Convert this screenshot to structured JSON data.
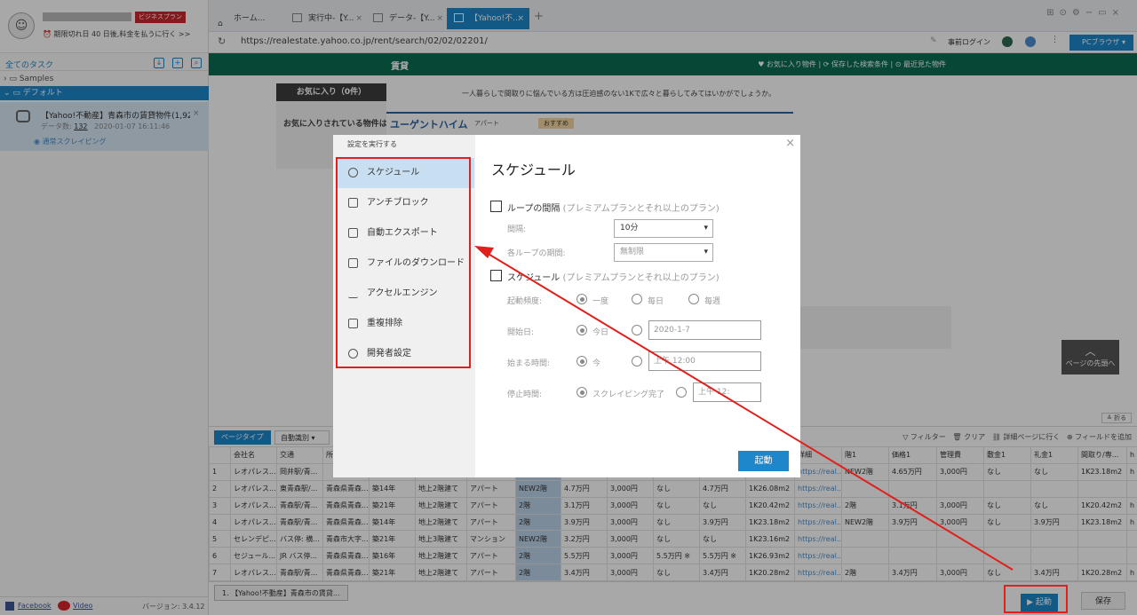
{
  "sidebar": {
    "account_badge": "ビジネスプラン",
    "expire_text": "期限切れ日 40 日後,料金を払うに行く >>",
    "task_header": "全てのタスク",
    "folder_samples": "Samples",
    "folder_default": "デフォルト",
    "task": {
      "title": "【Yahoo!不動産】青森市の賃貸物件(1,929...",
      "count_label": "データ数:",
      "count": "132",
      "date": "2020-01-07 16:11:46",
      "status": "通常スクレイピング"
    },
    "footer": {
      "facebook": "Facebook",
      "video": "Video",
      "version": "バージョン: 3.4.12"
    }
  },
  "browser": {
    "tabs": [
      {
        "label": "ホーム...",
        "active": false
      },
      {
        "label": "実行中-【Y...",
        "active": false
      },
      {
        "label": "データ-【Y...",
        "active": false
      },
      {
        "label": "【Yahoo!不...",
        "active": true
      }
    ],
    "url": "https://realestate.yahoo.co.jp/rent/search/02/02/02201/",
    "login": "事前ログイン",
    "pc_browser": "PCブラウザ"
  },
  "webpage": {
    "header_title": "賃貸",
    "nav": "♥ お気に入り物件  |  ⟳ 保存した検索条件  |  ⊙ 最近見た物件",
    "fav_title": "お気に入り（0件）",
    "fav_text": "お気に入りされている物件はあり",
    "promo": "一人暮らしで間取りに悩んでいる方は圧迫感のない1Kで広々と暮らしてみてはいかがでしょうか。",
    "urgent_title": "ユーゲントハイム",
    "urgent_type": "アパート",
    "urgent_tag": "おすすめ",
    "top_button": "ページの先頭へ",
    "fold": "折る"
  },
  "data_panel": {
    "page_type": "ページタイプ",
    "page_type_value": "自動識別",
    "tools": [
      "フィルター",
      "クリア",
      "詳細ページに行く",
      "フィールドを追加"
    ],
    "columns": [
      "",
      "会社名",
      "交通",
      "所",
      "",
      "",
      "",
      "",
      "",
      "",
      "",
      "",
      "",
      "詳細",
      "階1",
      "価格1",
      "管理費",
      "敷金1",
      "礼金1",
      "間取り/専...",
      "h"
    ],
    "rows": [
      [
        "1",
        "レオパレス...",
        "岡井駅/青...",
        "",
        "",
        "",
        "",
        "",
        "",
        "",
        "",
        "",
        "",
        "https://real...",
        "NEW2階",
        "4.65万円",
        "3,000円",
        "なし",
        "なし",
        "1K23.18m2",
        "h"
      ],
      [
        "2",
        "レオパレス...",
        "東青森駅/...",
        "青森県青森...",
        "築14年",
        "地上2階建て",
        "アパート",
        "NEW2階",
        "4.7万円",
        "3,000円",
        "なし",
        "4.7万円",
        "1K26.08m2",
        "https://real...",
        "",
        "",
        "",
        "",
        "",
        "",
        ""
      ],
      [
        "3",
        "レオパレス...",
        "青森駅/青...",
        "青森県青森...",
        "築21年",
        "地上2階建て",
        "アパート",
        "2階",
        "3.1万円",
        "3,000円",
        "なし",
        "なし",
        "1K20.42m2",
        "https://real...",
        "2階",
        "3.1万円",
        "3,000円",
        "なし",
        "なし",
        "1K20.42m2",
        "h"
      ],
      [
        "4",
        "レオパレス...",
        "青森駅/青...",
        "青森県青森...",
        "築14年",
        "地上2階建て",
        "アパート",
        "2階",
        "3.9万円",
        "3,000円",
        "なし",
        "3.9万円",
        "1K23.18m2",
        "https://real...",
        "NEW2階",
        "3.9万円",
        "3,000円",
        "なし",
        "3.9万円",
        "1K23.18m2",
        "h"
      ],
      [
        "5",
        "セレンデピ...",
        "バス停: 横...",
        "青森市大字...",
        "築21年",
        "地上3階建て",
        "マンション",
        "NEW2階",
        "3.2万円",
        "3,000円",
        "なし",
        "なし",
        "1K23.16m2",
        "https://real...",
        "",
        "",
        "",
        "",
        "",
        "",
        ""
      ],
      [
        "6",
        "セジュール...",
        "JR バス停...",
        "青森県青森...",
        "築16年",
        "地上2階建て",
        "アパート",
        "2階",
        "5.5万円",
        "3,000円",
        "5.5万円 ※",
        "5.5万円 ※",
        "1K26.93m2",
        "https://real...",
        "",
        "",
        "",
        "",
        "",
        "",
        ""
      ],
      [
        "7",
        "レオパレス...",
        "青森駅/青...",
        "青森県青森...",
        "築21年",
        "地上2階建て",
        "アパート",
        "2階",
        "3.4万円",
        "3,000円",
        "なし",
        "3.4万円",
        "1K20.28m2",
        "https://real...",
        "2階",
        "3.4万円",
        "3,000円",
        "なし",
        "3.4万円",
        "1K20.28m2",
        "h"
      ]
    ],
    "task_chip": "1. 【Yahoo!不動産】青森市の賃貸...",
    "start": "▶ 起動",
    "save": "保存"
  },
  "dialog": {
    "left_header": "設定を実行する",
    "menu": [
      {
        "label": "スケジュール",
        "icon": "clock-icon",
        "active": true
      },
      {
        "label": "アンチブロック",
        "icon": "shield-icon",
        "active": false
      },
      {
        "label": "自動エクスポート",
        "icon": "export-icon",
        "active": false
      },
      {
        "label": "ファイルのダウンロード",
        "icon": "file-download-icon",
        "active": false
      },
      {
        "label": "アクセルエンジン",
        "icon": "speed-icon",
        "active": false
      },
      {
        "label": "重複排除",
        "icon": "dedupe-icon",
        "active": false
      },
      {
        "label": "開発者設定",
        "icon": "gear-icon",
        "active": false
      }
    ],
    "title": "スケジュール",
    "loop_label": "ループの間隔",
    "premium_hint": "(プレミアムプランとそれ以上のプラン)",
    "interval_label": "間隔:",
    "interval_value": "10分",
    "period_label": "各ループの期間:",
    "period_value": "無制限",
    "schedule_label": "スケジュール",
    "frequency_label": "起動頻度:",
    "freq_options": [
      "一度",
      "毎日",
      "毎週"
    ],
    "start_date_label": "開始日:",
    "today": "今日",
    "start_date_value": "2020-1-7",
    "start_time_label": "始まる時間:",
    "now": "今",
    "start_time_value": "上午 12:00",
    "stop_label": "停止時間:",
    "stop_option": "スクレイピング完了",
    "stop_value": "上午 12:",
    "start_button": "起動"
  },
  "colors": {
    "accent": "#1e87cc",
    "header_green": "#0c6c53",
    "annotation_red": "#e0201c"
  }
}
